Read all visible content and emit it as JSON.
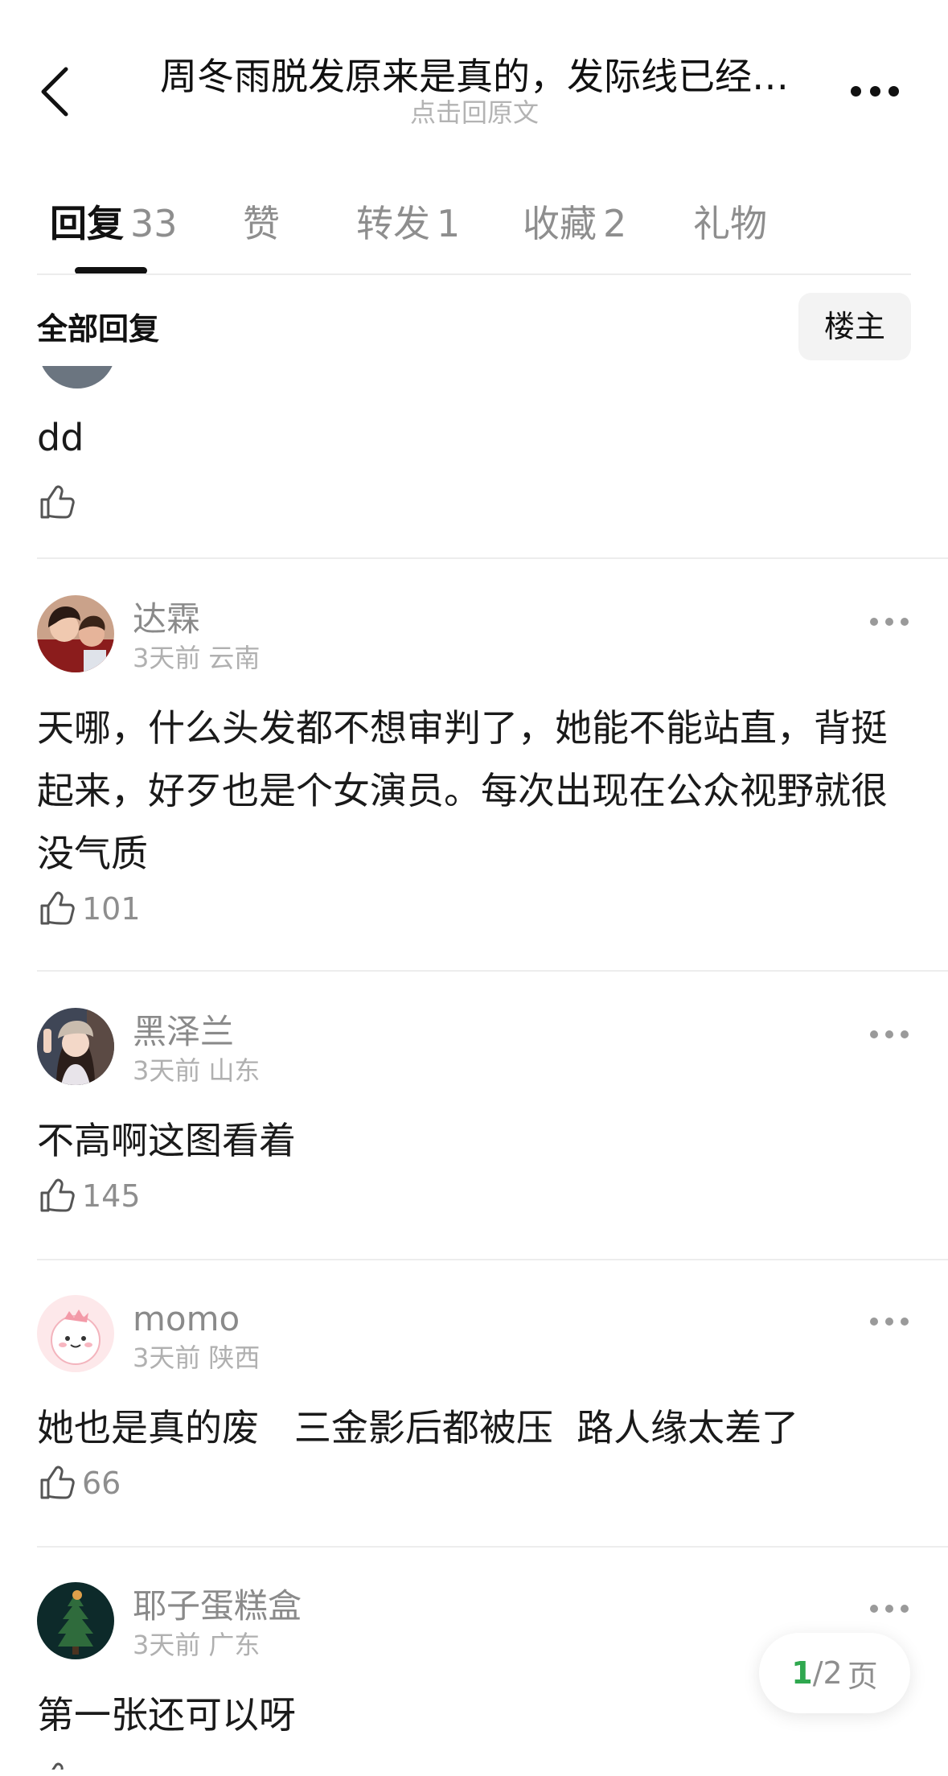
{
  "header": {
    "title": "周冬雨脱发原来是真的，发际线已经…",
    "subtitle": "点击回原文"
  },
  "tabs": [
    {
      "label": "回复",
      "count": "33",
      "active": true
    },
    {
      "label": "赞",
      "count": "",
      "active": false
    },
    {
      "label": "转发",
      "count": "1",
      "active": false
    },
    {
      "label": "收藏",
      "count": "2",
      "active": false
    },
    {
      "label": "礼物",
      "count": "",
      "active": false
    }
  ],
  "filter": {
    "title": "全部回复",
    "owner_button": "楼主"
  },
  "comments": [
    {
      "name": "",
      "time": "",
      "location": "",
      "text": "dd",
      "likes": ""
    },
    {
      "name": "达霖",
      "time": "3天前",
      "location": "云南",
      "text": "天哪，什么头发都不想审判了，她能不能站直，背挺起来，好歹也是个女演员。每次出现在公众视野就很没气质",
      "likes": "101"
    },
    {
      "name": "黑泽兰",
      "time": "3天前",
      "location": "山东",
      "text": "不高啊这图看着",
      "likes": "145"
    },
    {
      "name": "momo",
      "time": "3天前",
      "location": "陕西",
      "text": "她也是真的废   三金影后都被压  路人缘太差了",
      "likes": "66"
    },
    {
      "name": "耶子蛋糕盒",
      "time": "3天前",
      "location": "广东",
      "text": "第一张还可以呀",
      "likes": ""
    }
  ],
  "pagination": {
    "current": "1",
    "separator": "/",
    "total": "2",
    "suffix": "页"
  },
  "colors": {
    "page_current": "#2fa84f",
    "muted_text": "#8e8e8e",
    "divider": "#ededed"
  },
  "icons": {
    "back": "chevron-left-icon",
    "more": "more-horizontal-icon",
    "like": "thumbs-up-icon"
  }
}
